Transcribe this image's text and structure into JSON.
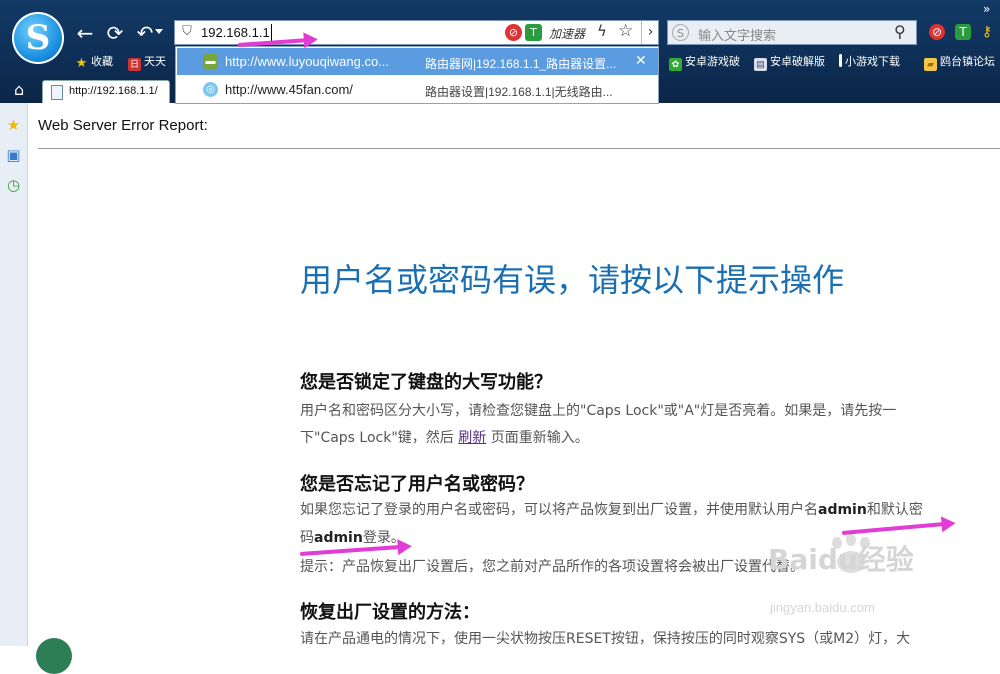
{
  "browser": {
    "logo_letter": "S",
    "address": "192.168.1.1",
    "accelerator_label": "加速器",
    "search_placeholder": "输入文字搜索",
    "menu_chevron": "»",
    "bookmarks": [
      {
        "label": "收藏",
        "icon": "star-icon"
      },
      {
        "label": "天天",
        "icon": "calendar-icon"
      },
      {
        "label": "安卓游戏破",
        "icon": "leaf-icon"
      },
      {
        "label": "安卓破解版",
        "icon": "page-icon"
      },
      {
        "label": "小游戏下载",
        "icon": "bar-icon"
      },
      {
        "label": "鸥台镇论坛",
        "icon": "folder-icon"
      }
    ],
    "tab_label": "http://192.168.1.1/"
  },
  "suggestions": [
    {
      "url": "http://www.luyouqiwang.co...",
      "desc": "路由器网|192.168.1.1_路由器设置...",
      "selected": true
    },
    {
      "url": "http://www.45fan.com/",
      "desc": "路由器设置|192.168.1.1|无线路由...",
      "selected": false
    }
  ],
  "page": {
    "report_title": "Web Server Error Report:",
    "main_title": "用户名或密码有误，请按以下提示操作",
    "section1": {
      "heading": "您是否锁定了键盘的大写功能？",
      "line1": "用户名和密码区分大小写，请检查您键盘上的\"Caps Lock\"或\"A\"灯是否亮着。如果是，请先按一",
      "line2_pre": "下\"Caps Lock\"键，然后 ",
      "refresh_link": "刷新",
      "line2_post": " 页面重新输入。"
    },
    "section2": {
      "heading": "您是否忘记了用户名或密码？",
      "line1_pre": "如果您忘记了登录的用户名或密码，可以将产品恢复到出厂设置，并使用默认用户名",
      "admin1": "admin",
      "line1_post": "和默认密",
      "line2_pre": "码",
      "admin2": "admin",
      "line2_post": "登录。",
      "tip": "提示：产品恢复出厂设置后，您之前对产品所作的各项设置将会被出厂设置代替。"
    },
    "section3": {
      "heading": "恢复出厂设置的方法：",
      "line1": "请在产品通电的情况下，使用一尖状物按压RESET按钮，保持按压的同时观察SYS（或M2）灯，大"
    }
  },
  "watermark": {
    "brand": "Baidu经验",
    "url": "jingyan.baidu.com"
  },
  "colors": {
    "title_blue": "#1a6fb3",
    "arrow_magenta": "#e23bd6",
    "selection_blue": "#5b9be0",
    "chrome_navy": "#123a66"
  }
}
